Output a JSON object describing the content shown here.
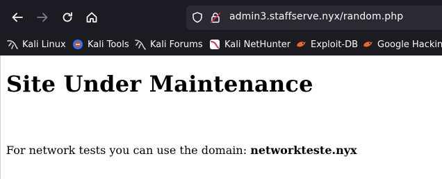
{
  "browser": {
    "url_host": "admin3.staffserve.nyx",
    "url_path": "/random.php",
    "nav": [
      "back-icon",
      "forward-icon",
      "reload-icon",
      "home-icon"
    ],
    "bookmarks": [
      {
        "label": "Kali Linux",
        "icon": "kali-linux-icon"
      },
      {
        "label": "Kali Tools",
        "icon": "kali-tools-icon"
      },
      {
        "label": "Kali Forums",
        "icon": "kali-forums-icon"
      },
      {
        "label": "Kali NetHunter",
        "icon": "kali-nethunter-icon"
      },
      {
        "label": "Exploit-DB",
        "icon": "exploit-db-icon"
      },
      {
        "label": "Google Hacking",
        "icon": "google-hacking-icon"
      }
    ],
    "colors": {
      "chrome_bg": "#1c1b22",
      "urlbar_bg": "#2b2a33",
      "text": "#fbfbfe"
    }
  },
  "page": {
    "title": "Site Under Maintenance",
    "message_prefix": "For network tests you can use the domain: ",
    "message_domain": "networkteste.nyx"
  }
}
